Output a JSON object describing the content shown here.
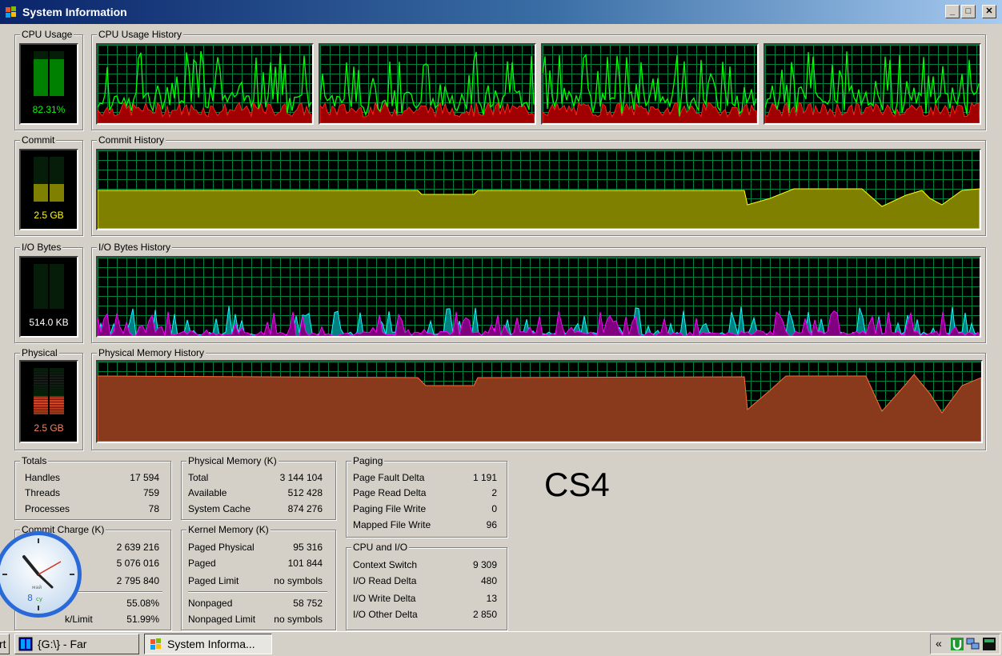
{
  "window": {
    "title": "System Information",
    "minimize": "_",
    "maximize": "□",
    "close": "✕"
  },
  "colors": {
    "cpu": "#00ff00",
    "cpu_kernel": "#ff0000",
    "commit": "#ffff00",
    "physical": "#ff6a3a",
    "io_read": "#ff00ff",
    "io_write": "#00ffff",
    "grid": "#008040"
  },
  "cpu": {
    "label": "CPU Usage",
    "value": "82.31%",
    "history_label": "CPU Usage History",
    "fraction": 0.8231
  },
  "commit": {
    "label": "Commit",
    "value": "2.5 GB",
    "history_label": "Commit History"
  },
  "io": {
    "label": "I/O Bytes",
    "value": "514.0  KB",
    "history_label": "I/O Bytes History"
  },
  "physical": {
    "label": "Physical",
    "value": "2.5 GB",
    "history_label": "Physical Memory History"
  },
  "totals": {
    "title": "Totals",
    "rows": [
      {
        "label": "Handles",
        "value": "17 594"
      },
      {
        "label": "Threads",
        "value": "759"
      },
      {
        "label": "Processes",
        "value": "78"
      }
    ]
  },
  "commit_charge": {
    "title": "Commit Charge (K)",
    "rows": [
      {
        "label": "",
        "value": "2 639 216"
      },
      {
        "label": "",
        "value": "5 076 016"
      },
      {
        "label": "",
        "value": "2 795 840"
      },
      {
        "label": "",
        "value": "55.08%"
      },
      {
        "label": "k/Limit",
        "value": "51.99%"
      }
    ]
  },
  "physical_memory": {
    "title": "Physical Memory (K)",
    "rows": [
      {
        "label": "Total",
        "value": "3 144 104"
      },
      {
        "label": "Available",
        "value": "512 428"
      },
      {
        "label": "System Cache",
        "value": "874 276"
      }
    ]
  },
  "kernel_memory": {
    "title": "Kernel Memory (K)",
    "rows": [
      {
        "label": "Paged Physical",
        "value": "95 316"
      },
      {
        "label": "Paged",
        "value": "101 844"
      },
      {
        "label": "Paged Limit",
        "value": "no symbols"
      },
      {
        "label": "Nonpaged",
        "value": "58 752"
      },
      {
        "label": "Nonpaged Limit",
        "value": "no symbols"
      }
    ]
  },
  "paging": {
    "title": "Paging",
    "rows": [
      {
        "label": "Page Fault Delta",
        "value": "1 191"
      },
      {
        "label": "Page Read Delta",
        "value": "2"
      },
      {
        "label": "Paging File Write",
        "value": "0"
      },
      {
        "label": "Mapped File Write",
        "value": "96"
      }
    ]
  },
  "cpu_io": {
    "title": "CPU and I/O",
    "rows": [
      {
        "label": "Context Switch",
        "value": "9 309"
      },
      {
        "label": "I/O Read Delta",
        "value": "480"
      },
      {
        "label": "I/O Write Delta",
        "value": "13"
      },
      {
        "label": "I/O Other Delta",
        "value": "2 850"
      }
    ]
  },
  "overlay_text": "CS4",
  "clock": {
    "day": "8",
    "day_suffix": "су",
    "month": "май"
  },
  "taskbar": {
    "start_fragment": "rt",
    "tasks": [
      {
        "label": "{G:\\} - Far",
        "icon": "far-manager-icon"
      },
      {
        "label": "System Informa...",
        "icon": "system-info-icon"
      }
    ],
    "tray_chevron": "«",
    "tray_icons": [
      "utorrent-icon",
      "network-icon",
      "terminal-icon"
    ]
  }
}
